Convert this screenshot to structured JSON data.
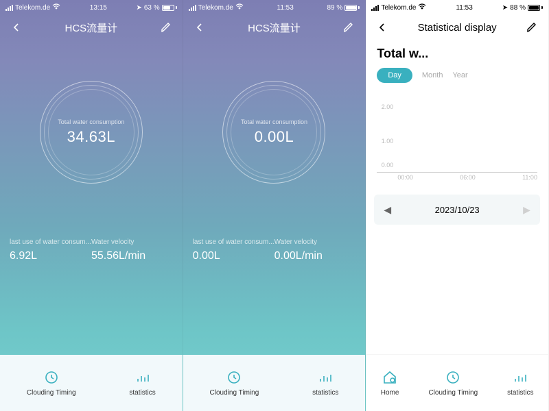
{
  "screens": [
    {
      "status": {
        "carrier": "Telekom.de",
        "time": "13:15",
        "battery_pct": "63 %",
        "battery_fill": 0.63,
        "location_arrow": true
      },
      "header": {
        "title": "HCS流量计"
      },
      "gauge": {
        "label": "Total water consumption",
        "value": "34.63L"
      },
      "metrics": {
        "last_use_label": "last use of water consum...",
        "last_use_value": "6.92L",
        "velocity_label": "Water velocity",
        "velocity_value": "55.56L/min"
      },
      "nav": {
        "clouding": "Clouding Timing",
        "stats": "statistics"
      }
    },
    {
      "status": {
        "carrier": "Telekom.de",
        "time": "11:53",
        "battery_pct": "89 %",
        "battery_fill": 0.89,
        "location_arrow": false
      },
      "header": {
        "title": "HCS流量计"
      },
      "gauge": {
        "label": "Total water consumption",
        "value": "0.00L"
      },
      "metrics": {
        "last_use_label": "last use of water consum...",
        "last_use_value": "0.00L",
        "velocity_label": "Water velocity",
        "velocity_value": "0.00L/min"
      },
      "nav": {
        "clouding": "Clouding Timing",
        "stats": "statistics"
      }
    },
    {
      "status": {
        "carrier": "Telekom.de",
        "time": "11:53",
        "battery_pct": "88 %",
        "battery_fill": 0.88,
        "location_arrow": true
      },
      "header": {
        "title": "Statistical display"
      },
      "section_title": "Total w...",
      "segmented": {
        "day": "Day",
        "month": "Month",
        "year": "Year"
      },
      "chart_axis": {
        "y": [
          "2.00",
          "1.00",
          "0.00"
        ],
        "x": [
          "00:00",
          "06:00",
          "11:00"
        ]
      },
      "date_nav": {
        "date": "2023/10/23"
      },
      "nav": {
        "home": "Home",
        "clouding": "Clouding Timing",
        "stats": "statistics"
      }
    }
  ],
  "chart_data": {
    "type": "line",
    "title": "Total w...",
    "xlabel": "",
    "ylabel": "",
    "ylim": [
      0,
      2.0
    ],
    "x_ticks": [
      "00:00",
      "06:00",
      "11:00"
    ],
    "series": [
      {
        "name": "Day",
        "values": [
          0,
          0,
          0
        ]
      }
    ]
  }
}
